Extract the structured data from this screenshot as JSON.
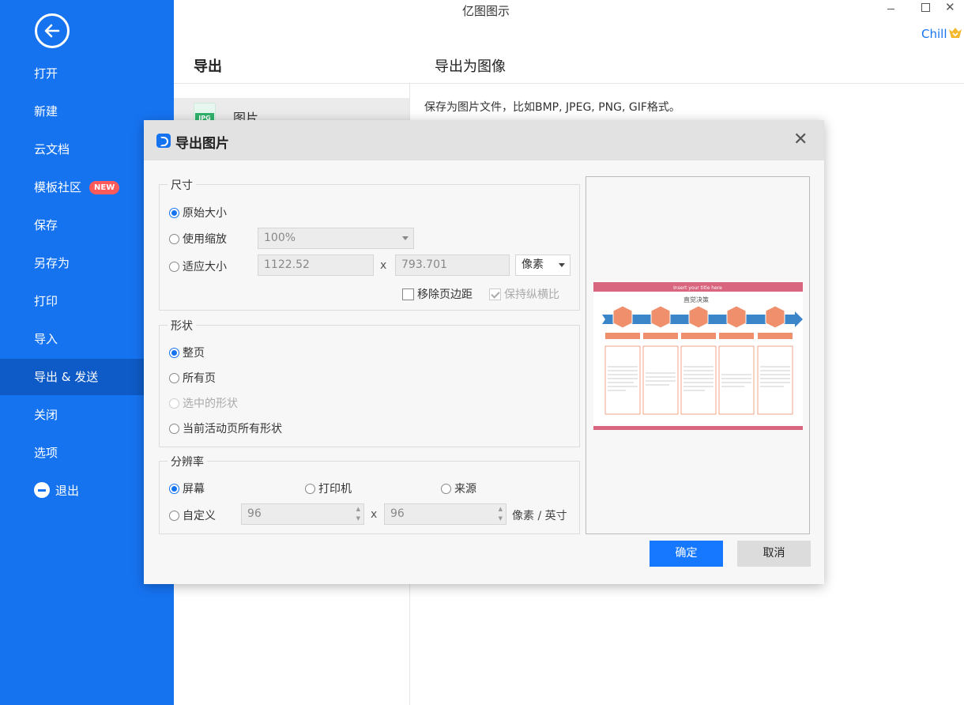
{
  "window": {
    "title": "亿图图示",
    "close_glyph": "✕"
  },
  "user": {
    "name": "Chill",
    "badge_icon": "crown-icon"
  },
  "sidebar": {
    "back_icon": "arrow-left-icon",
    "items": [
      {
        "label": "打开"
      },
      {
        "label": "新建"
      },
      {
        "label": "云文档"
      },
      {
        "label": "模板社区",
        "badge": "NEW"
      },
      {
        "label": "保存"
      },
      {
        "label": "另存为"
      },
      {
        "label": "打印"
      },
      {
        "label": "导入"
      },
      {
        "label": "导出 & 发送",
        "active": true
      },
      {
        "label": "关闭"
      },
      {
        "label": "选项"
      },
      {
        "label": "退出",
        "icon": "exit-icon"
      }
    ]
  },
  "panel": {
    "left_heading": "导出",
    "right_heading": "导出为图像",
    "format_item": {
      "icon_text": "JPG",
      "label": "图片"
    },
    "description": "保存为图片文件，比如BMP, JPEG, PNG, GIF格式。"
  },
  "dialog": {
    "title": "导出图片",
    "close_glyph": "✕",
    "size_group": {
      "legend": "尺寸",
      "original": "原始大小",
      "use_scale": "使用缩放",
      "scale_value": "100%",
      "fit_size": "适应大小",
      "width": "1122.52",
      "times": "x",
      "height": "793.701",
      "unit": "像素",
      "remove_margin": "移除页边距",
      "keep_ratio": "保持纵横比",
      "selected": "原始大小"
    },
    "shape_group": {
      "legend": "形状",
      "whole_page": "整页",
      "all_pages": "所有页",
      "selected_shapes": "选中的形状",
      "current_page_shapes": "当前活动页所有形状",
      "selected": "整页"
    },
    "resolution_group": {
      "legend": "分辨率",
      "screen": "屏幕",
      "printer": "打印机",
      "source": "来源",
      "custom": "自定义",
      "dpi_x": "96",
      "times": "x",
      "dpi_y": "96",
      "unit": "像素 / 英寸",
      "selected": "屏幕"
    },
    "preview": {
      "banner_title": "Insert your title here",
      "diagram_title": "直觉决策"
    },
    "ok_label": "确定",
    "cancel_label": "取消"
  },
  "colors": {
    "sidebar_bg": "#1673f0",
    "sidebar_active": "#0e5ac6",
    "primary_button": "#1677ff",
    "badge_new": "#ff5a5a",
    "accent_gold": "#f5b82e",
    "preview_band": "#d9667f",
    "preview_shape": "#ef8f6c",
    "preview_arrow": "#3a86c8"
  }
}
